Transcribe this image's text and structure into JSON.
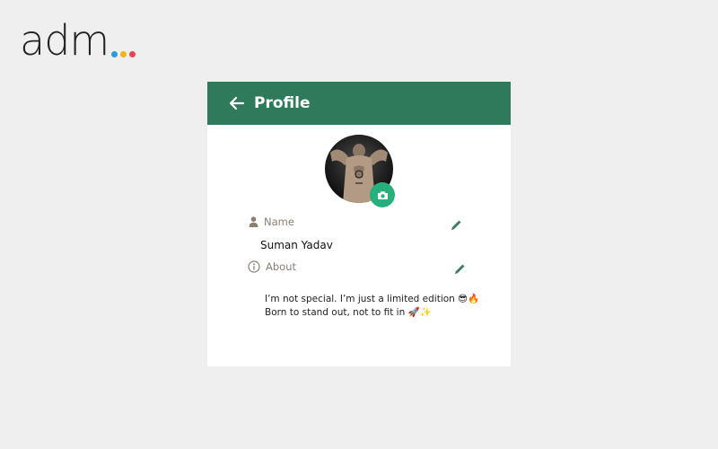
{
  "brand": {
    "logo_text": "adm",
    "dot_colors": [
      "#2f9bd6",
      "#f2b21b",
      "#e5484d"
    ]
  },
  "colors": {
    "appbar": "#2f7a5a",
    "camera_button": "#27b07e",
    "label": "#8a7f70",
    "edit_icon": "#3b7d63"
  },
  "appbar": {
    "title": "Profile",
    "back_icon": "arrow-left-icon"
  },
  "profile": {
    "avatar_icon": "profile-photo",
    "camera_icon": "camera-icon",
    "name_label": "Name",
    "name_value": "Suman Yadav",
    "name_icon": "person-icon",
    "about_label": "About",
    "about_icon": "info-icon",
    "about_line1": "I’m not special. I’m just a limited edition 😎🔥",
    "about_line2": "Born to stand out, not to fit in 🚀✨",
    "edit_icon": "pencil-icon"
  }
}
